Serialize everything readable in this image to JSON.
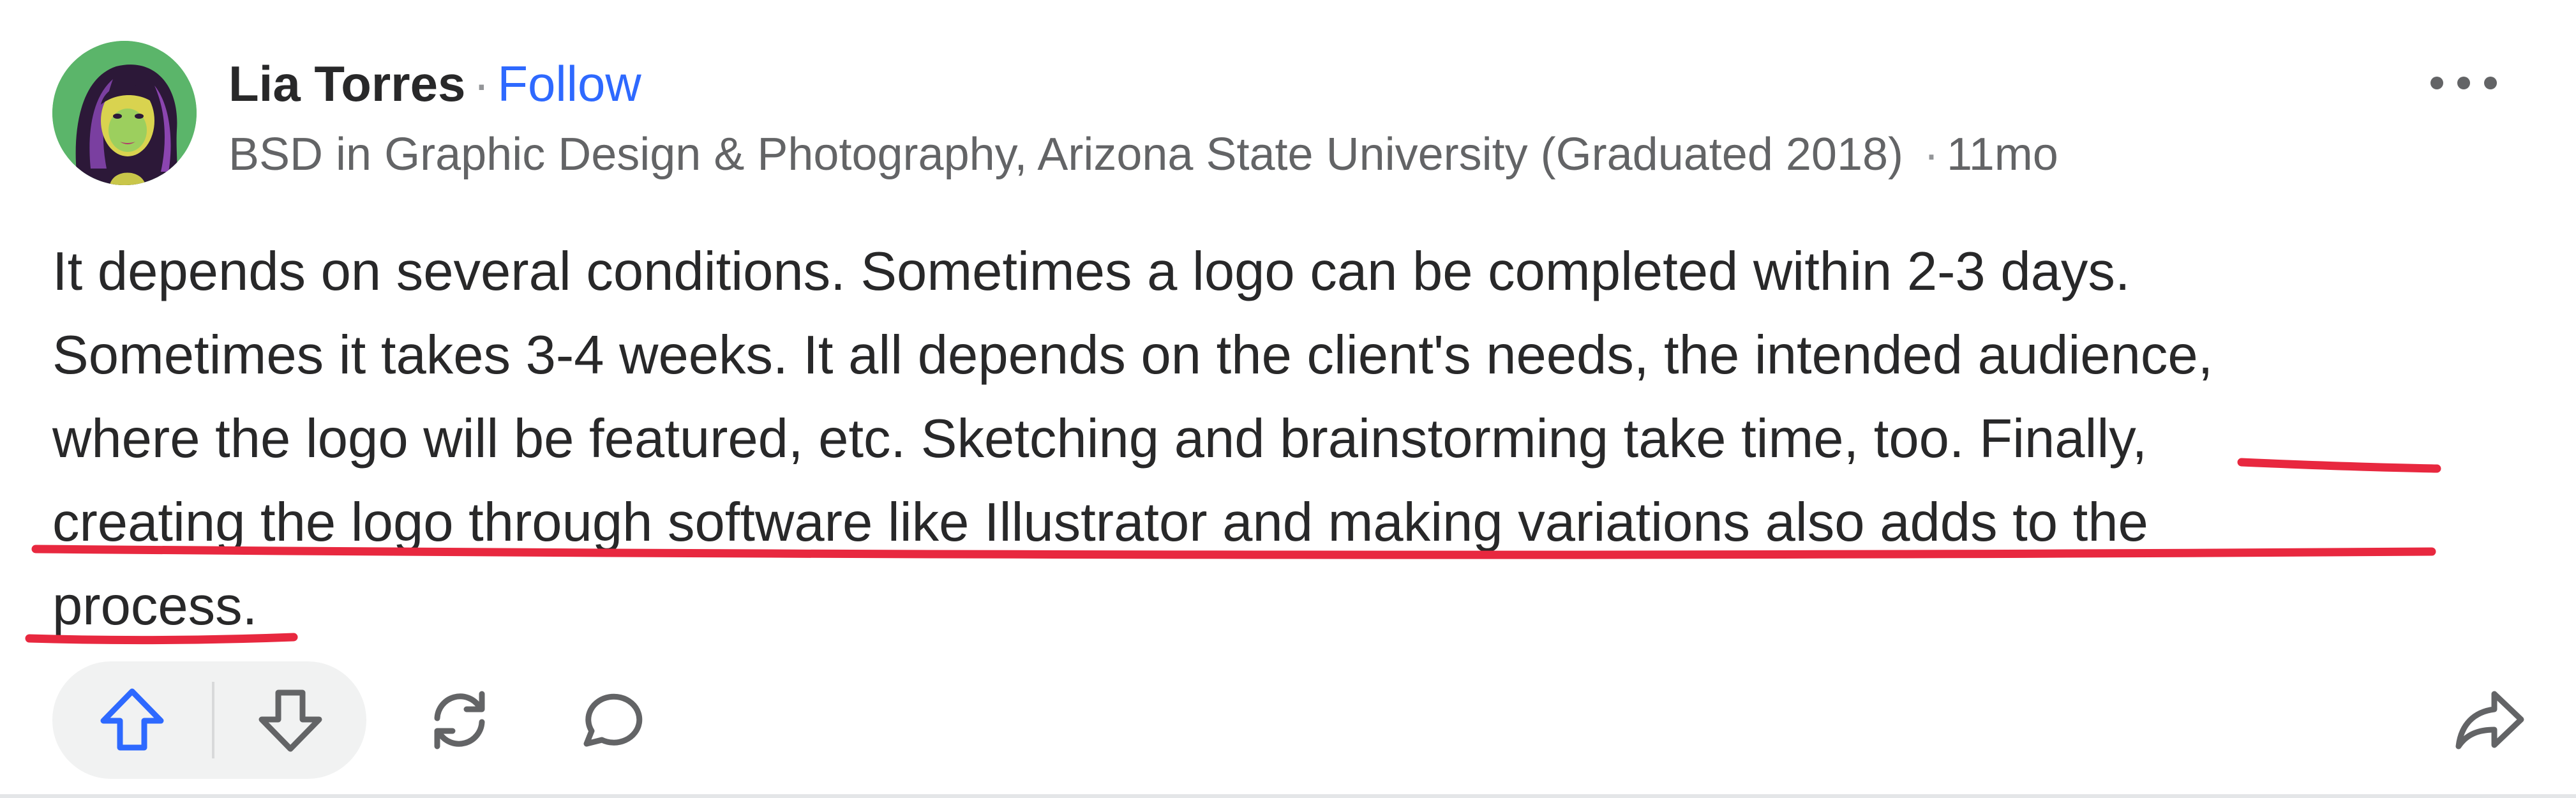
{
  "author": {
    "name": "Lia Torres",
    "separator": "·",
    "follow_label": "Follow",
    "credential": "BSD in Graphic Design & Photography, Arizona State University (Graduated 2018)",
    "time_separator": "·",
    "posted_ago": "11mo"
  },
  "answer": {
    "lines": [
      "It depends on several conditions. Sometimes a logo can be completed within 2-3 days.",
      "Sometimes it takes 3-4 weeks. It all depends on the client's needs, the intended audience,",
      "where the logo will be featured, etc. Sketching and brainstorming take time, too. Finally,",
      "creating the logo through software like Illustrator and making variations also adds to the",
      "process."
    ]
  },
  "icons": {
    "avatar": "avatar-illustration",
    "more": "more-options-icon",
    "upvote": "upvote-arrow-icon",
    "downvote": "downvote-arrow-icon",
    "reshare": "reshare-icon",
    "comment": "comment-bubble-icon",
    "share": "share-arrow-icon"
  },
  "colors": {
    "follow": "#2e69ff",
    "upvote_active": "#2e69ff",
    "annotation_underline": "#e8283f",
    "avatar_background": "#5bb56a",
    "text_primary": "#282829",
    "text_secondary": "#636466"
  }
}
